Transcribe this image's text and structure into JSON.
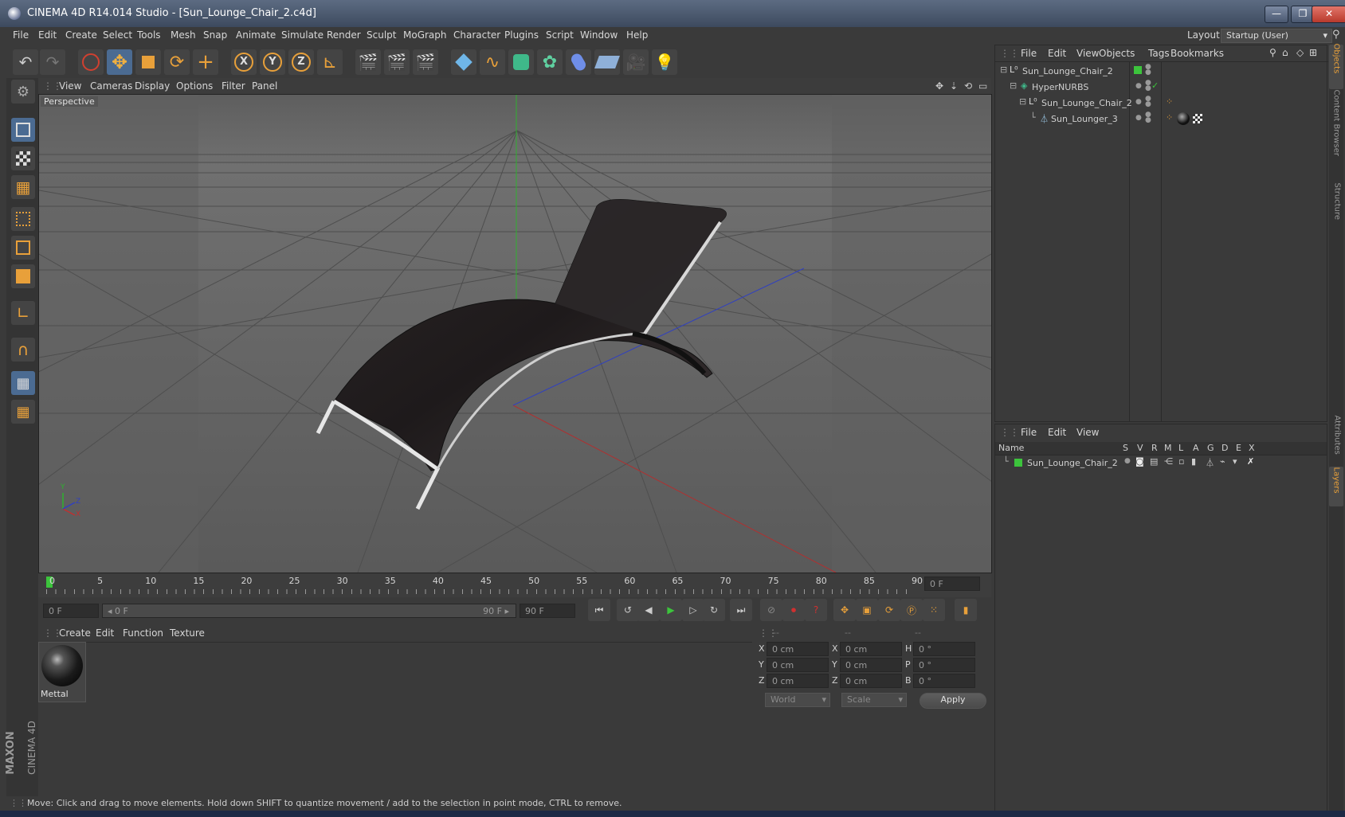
{
  "window": {
    "title": "CINEMA 4D R14.014 Studio - [Sun_Lounge_Chair_2.c4d]",
    "minimize": "—",
    "restore": "❐",
    "close": "✕"
  },
  "menubar": {
    "items": [
      "File",
      "Edit",
      "Create",
      "Select",
      "Tools",
      "Mesh",
      "Snap",
      "Animate",
      "Simulate",
      "Render",
      "Sculpt",
      "MoGraph",
      "Character",
      "Plugins",
      "Script",
      "Window",
      "Help"
    ],
    "layout_label": "Layout:",
    "layout_value": "Startup (User)"
  },
  "viewport": {
    "menu": [
      "View",
      "Cameras",
      "Display",
      "Options",
      "Filter",
      "Panel"
    ],
    "label": "Perspective",
    "axis_y": "Y",
    "axis_x": "X",
    "axis_z": "Z"
  },
  "timeline": {
    "ticks": [
      "0",
      "5",
      "10",
      "15",
      "20",
      "25",
      "30",
      "35",
      "40",
      "45",
      "50",
      "55",
      "60",
      "65",
      "70",
      "75",
      "80",
      "85",
      "90"
    ],
    "current_frame": "0 F"
  },
  "transport": {
    "start_field": "0 F",
    "range_start": "◂ 0 F",
    "range_end": "90 F ▸",
    "end_field": "90 F"
  },
  "material_panel": {
    "menu": [
      "Create",
      "Edit",
      "Function",
      "Texture"
    ],
    "material_name": "Mettal"
  },
  "coord_panel": {
    "headers": [
      "--",
      "--",
      "--"
    ],
    "rows": [
      {
        "l1": "X",
        "v1": "0 cm",
        "l2": "X",
        "v2": "0 cm",
        "l3": "H",
        "v3": "0 °"
      },
      {
        "l1": "Y",
        "v1": "0 cm",
        "l2": "Y",
        "v2": "0 cm",
        "l3": "P",
        "v3": "0 °"
      },
      {
        "l1": "Z",
        "v1": "0 cm",
        "l2": "Z",
        "v2": "0 cm",
        "l3": "B",
        "v3": "0 °"
      }
    ],
    "dropdown1": "World",
    "dropdown2": "Scale",
    "apply": "Apply"
  },
  "objects_panel": {
    "menu": [
      "File",
      "Edit",
      "View",
      "Objects",
      "Tags",
      "Bookmarks"
    ],
    "tree": [
      {
        "name": "Sun_Lounge_Chair_2",
        "indent": 0
      },
      {
        "name": "HyperNURBS",
        "indent": 1
      },
      {
        "name": "Sun_Lounge_Chair_2",
        "indent": 2
      },
      {
        "name": "Sun_Lounger_3",
        "indent": 3
      }
    ]
  },
  "layers_panel": {
    "menu": [
      "File",
      "Edit",
      "View"
    ],
    "columns": [
      "Name",
      "S",
      "V",
      "R",
      "M",
      "L",
      "A",
      "G",
      "D",
      "E",
      "X"
    ],
    "rows": [
      {
        "name": "Sun_Lounge_Chair_2"
      }
    ]
  },
  "side_tabs": [
    "Objects",
    "Content Browser",
    "Structure",
    "Attributes",
    "Layers"
  ],
  "brand": {
    "top": "MAXON",
    "bottom": "CINEMA 4D"
  },
  "status": "Move: Click and drag to move elements. Hold down SHIFT to quantize movement / add to the selection in point mode, CTRL to remove.",
  "colors": {
    "accent": "#4b6b92",
    "green": "#3cc43c",
    "orange": "#e8a03a"
  }
}
